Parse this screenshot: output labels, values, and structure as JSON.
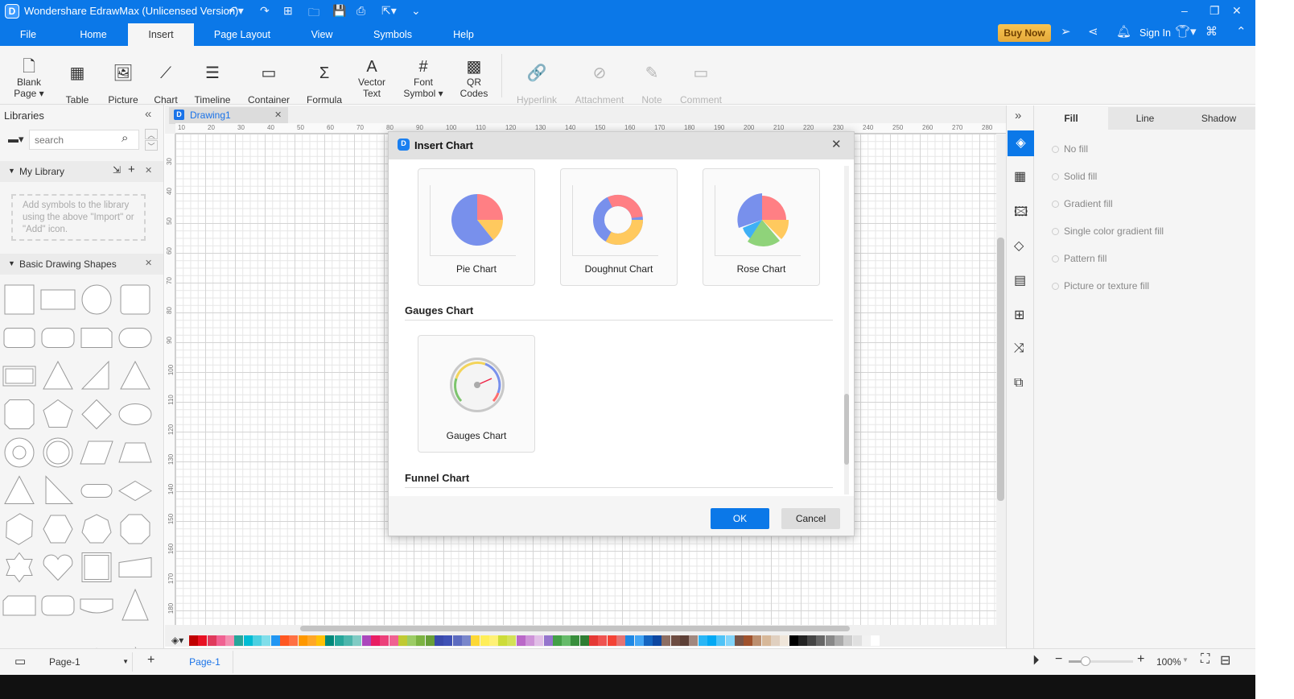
{
  "app": {
    "title": "Wondershare EdrawMax (Unlicensed Version)"
  },
  "menu": [
    "File",
    "Home",
    "Insert",
    "Page Layout",
    "View",
    "Symbols",
    "Help"
  ],
  "header": {
    "buy_now": "Buy Now",
    "sign_in": "Sign In"
  },
  "ribbon": [
    {
      "l1": "Blank",
      "l2": "Page ▾",
      "icon": "🗋",
      "name": "blank-page"
    },
    {
      "l1": "",
      "l2": "Table",
      "icon": "▦",
      "name": "table"
    },
    {
      "l1": "",
      "l2": "Picture",
      "icon": "🖼",
      "name": "picture"
    },
    {
      "l1": "",
      "l2": "Chart",
      "icon": "⟋",
      "name": "chart"
    },
    {
      "l1": "",
      "l2": "Timeline",
      "icon": "☰",
      "name": "timeline"
    },
    {
      "l1": "",
      "l2": "Container",
      "icon": "▭",
      "name": "container"
    },
    {
      "l1": "",
      "l2": "Formula",
      "icon": "Σ",
      "name": "formula"
    },
    {
      "l1": "Vector",
      "l2": "Text",
      "icon": "A",
      "name": "vector-text"
    },
    {
      "l1": "Font",
      "l2": "Symbol ▾",
      "icon": "#",
      "name": "font-symbol"
    },
    {
      "l1": "QR",
      "l2": "Codes",
      "icon": "▩",
      "name": "qr-codes"
    },
    {
      "l1": "",
      "l2": "Hyperlink",
      "icon": "🔗",
      "name": "hyperlink"
    },
    {
      "l1": "",
      "l2": "Attachment",
      "icon": "⊘",
      "name": "attachment"
    },
    {
      "l1": "",
      "l2": "Note",
      "icon": "✎",
      "name": "note"
    },
    {
      "l1": "",
      "l2": "Comment",
      "icon": "▭",
      "name": "comment"
    }
  ],
  "libraries": {
    "title": "Libraries",
    "search_placeholder": "search",
    "my_library": "My Library",
    "my_library_hint": "Add symbols to the library using the above \"Import\" or \"Add\" icon.",
    "basic_shapes": "Basic Drawing Shapes"
  },
  "document": {
    "tab": "Drawing1"
  },
  "ruler_h": [
    "10",
    "20",
    "30",
    "40",
    "50",
    "60",
    "70",
    "80",
    "90",
    "100",
    "110",
    "120",
    "130",
    "140",
    "150",
    "160",
    "170",
    "180",
    "190",
    "200",
    "210",
    "220",
    "230",
    "240",
    "250",
    "260",
    "270",
    "280"
  ],
  "ruler_v": [
    "30",
    "40",
    "50",
    "60",
    "70",
    "80",
    "90",
    "100",
    "110",
    "120",
    "130",
    "140",
    "150",
    "160",
    "170",
    "180"
  ],
  "dialog": {
    "title": "Insert Chart",
    "charts": [
      "Pie Chart",
      "Doughnut Chart",
      "Rose Chart"
    ],
    "gauges_heading": "Gauges Chart",
    "gauges": "Gauges Chart",
    "funnel_heading": "Funnel Chart",
    "ok": "OK",
    "cancel": "Cancel"
  },
  "properties": {
    "tabs": [
      "Fill",
      "Line",
      "Shadow"
    ],
    "options": [
      "No fill",
      "Solid fill",
      "Gradient fill",
      "Single color gradient fill",
      "Pattern fill",
      "Picture or texture fill"
    ]
  },
  "status": {
    "page_select": "Page-1",
    "page_tab": "Page-1",
    "zoom": "100%"
  },
  "colors": {
    "accent": "#0b78e8",
    "buy": "#f0b545"
  },
  "palette": [
    "#c00000",
    "#e81123",
    "#e03a5c",
    "#f06292",
    "#f48fb1",
    "#26a69a",
    "#00bcd4",
    "#4dd0e1",
    "#80deea",
    "#2196f3",
    "#ff5722",
    "#ff7043",
    "#ff9800",
    "#ffa726",
    "#ffc107",
    "#00897b",
    "#26a69a",
    "#4db6ac",
    "#80cbc4",
    "#ab47bc",
    "#e91e63",
    "#ec407a",
    "#f06292",
    "#c0ca33",
    "#9ccc65",
    "#7cb342",
    "#689f38",
    "#3949ab",
    "#3f51b5",
    "#5c6bc0",
    "#7986cb",
    "#fdd835",
    "#ffee58",
    "#fff176",
    "#cddc39",
    "#d4e157",
    "#ba68c8",
    "#ce93d8",
    "#e1bee7",
    "#9575cd",
    "#43a047",
    "#66bb6a",
    "#388e3c",
    "#2e7d32",
    "#e53935",
    "#ef5350",
    "#f44336",
    "#e57373",
    "#1e88e5",
    "#42a5f5",
    "#1565c0",
    "#0d47a1",
    "#8d6e63",
    "#6d4c41",
    "#5d4037",
    "#a1887f",
    "#29b6f6",
    "#03a9f4",
    "#4fc3f7",
    "#81d4fa",
    "#795548",
    "#a0522d",
    "#bc8f6f",
    "#d7b899",
    "#e0d0c0",
    "#f0e6da",
    "#000000",
    "#222222",
    "#444444",
    "#666666",
    "#888888",
    "#aaaaaa",
    "#cccccc",
    "#e0e0e0",
    "#f2f2f2",
    "#ffffff"
  ]
}
